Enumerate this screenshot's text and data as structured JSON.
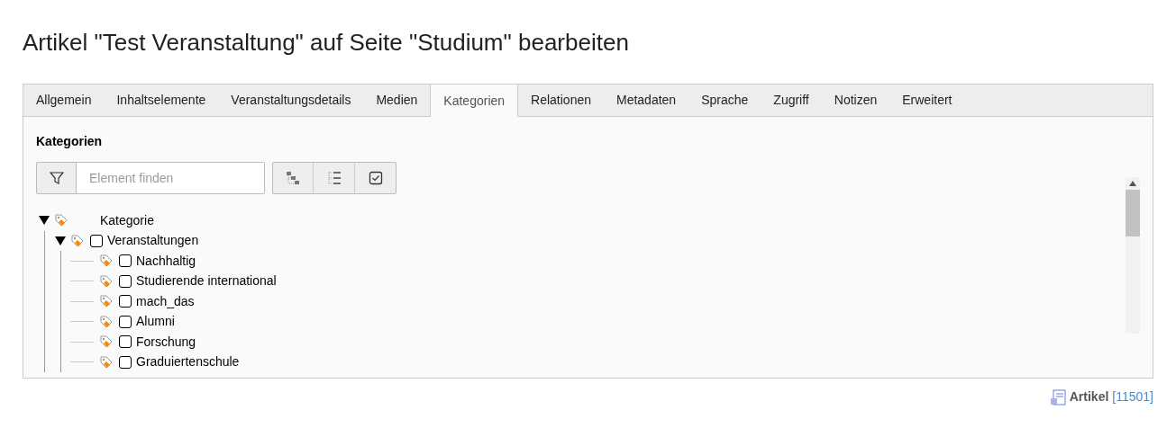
{
  "page_title": "Artikel \"Test Veranstaltung\" auf Seite \"Studium\" bearbeiten",
  "tabs": [
    {
      "label": "Allgemein",
      "selected": false
    },
    {
      "label": "Inhaltselemente",
      "selected": false
    },
    {
      "label": "Veranstaltungsdetails",
      "selected": false
    },
    {
      "label": "Medien",
      "selected": false
    },
    {
      "label": "Kategorien",
      "selected": true
    },
    {
      "label": "Relationen",
      "selected": false
    },
    {
      "label": "Metadaten",
      "selected": false
    },
    {
      "label": "Sprache",
      "selected": false
    },
    {
      "label": "Zugriff",
      "selected": false
    },
    {
      "label": "Notizen",
      "selected": false
    },
    {
      "label": "Erweitert",
      "selected": false
    }
  ],
  "section_title": "Kategorien",
  "search": {
    "placeholder": "Element finden"
  },
  "tree": [
    {
      "label": "Kategorie",
      "expanded": true,
      "children": [
        {
          "label": "Veranstaltungen",
          "expanded": true,
          "checked": false,
          "children": [
            {
              "label": "Nachhaltig",
              "checked": false
            },
            {
              "label": "Studierende international",
              "checked": false
            },
            {
              "label": "mach_das",
              "checked": false
            },
            {
              "label": "Alumni",
              "checked": false
            },
            {
              "label": "Forschung",
              "checked": false
            },
            {
              "label": "Graduiertenschule",
              "checked": false
            }
          ]
        }
      ]
    }
  ],
  "footer": {
    "type": "Artikel",
    "id": "[11501]"
  }
}
